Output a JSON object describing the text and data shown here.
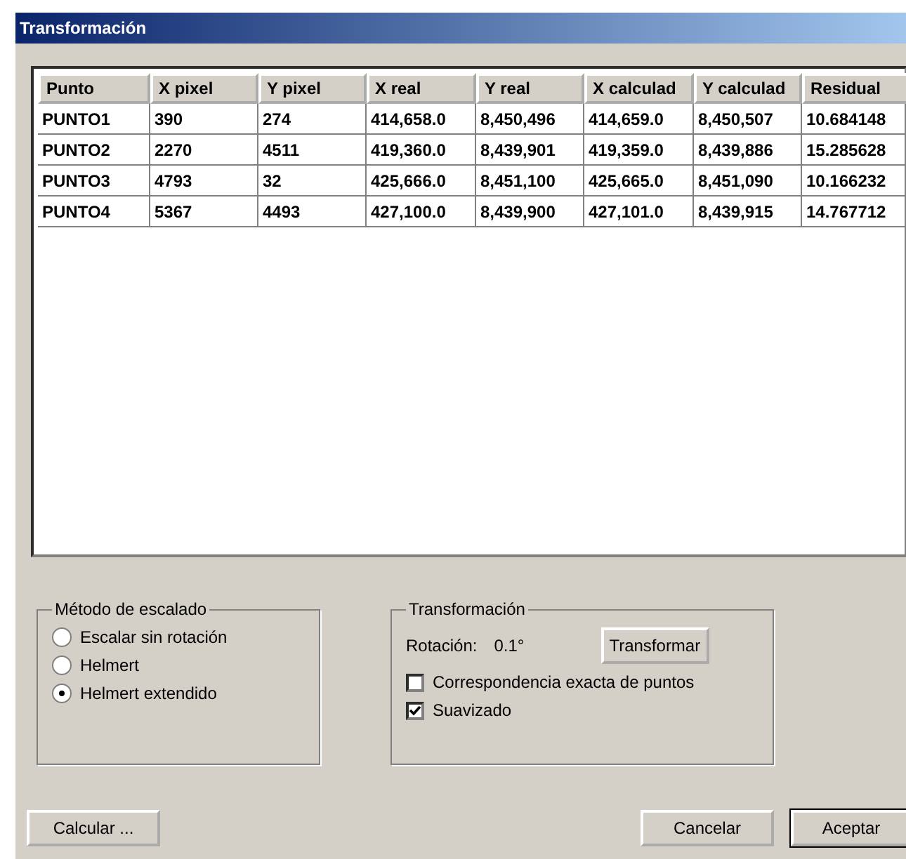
{
  "window": {
    "title": "Transformación"
  },
  "table": {
    "columns": [
      "Punto",
      "X pixel",
      "Y pixel",
      "X real",
      "Y real",
      "X calculad",
      "Y calculad",
      "Residual"
    ],
    "rows": [
      [
        "PUNTO1",
        "390",
        "274",
        "414,658.0",
        "8,450,496",
        "414,659.0",
        "8,450,507",
        "10.684148"
      ],
      [
        "PUNTO2",
        "2270",
        "4511",
        "419,360.0",
        "8,439,901",
        "419,359.0",
        "8,439,886",
        "15.285628"
      ],
      [
        "PUNTO3",
        "4793",
        "32",
        "425,666.0",
        "8,451,100",
        "425,665.0",
        "8,451,090",
        "10.166232"
      ],
      [
        "PUNTO4",
        "5367",
        "4493",
        "427,100.0",
        "8,439,900",
        "427,101.0",
        "8,439,915",
        "14.767712"
      ]
    ]
  },
  "scaling_group": {
    "title": "Método de escalado",
    "options": [
      {
        "label": "Escalar sin rotación",
        "selected": false
      },
      {
        "label": "Helmert",
        "selected": false
      },
      {
        "label": "Helmert extendido",
        "selected": true
      }
    ]
  },
  "transform_group": {
    "title": "Transformación",
    "rotation_label": "Rotación:",
    "rotation_value": "0.1°",
    "button": "Transformar",
    "options": [
      {
        "label": "Correspondencia exacta de puntos",
        "checked": false
      },
      {
        "label": "Suavizado",
        "checked": true
      }
    ]
  },
  "buttons": [
    {
      "label": "Calcular ...",
      "default": false
    },
    {
      "label": "Cancelar",
      "default": false
    },
    {
      "label": "Aceptar",
      "default": true
    }
  ]
}
